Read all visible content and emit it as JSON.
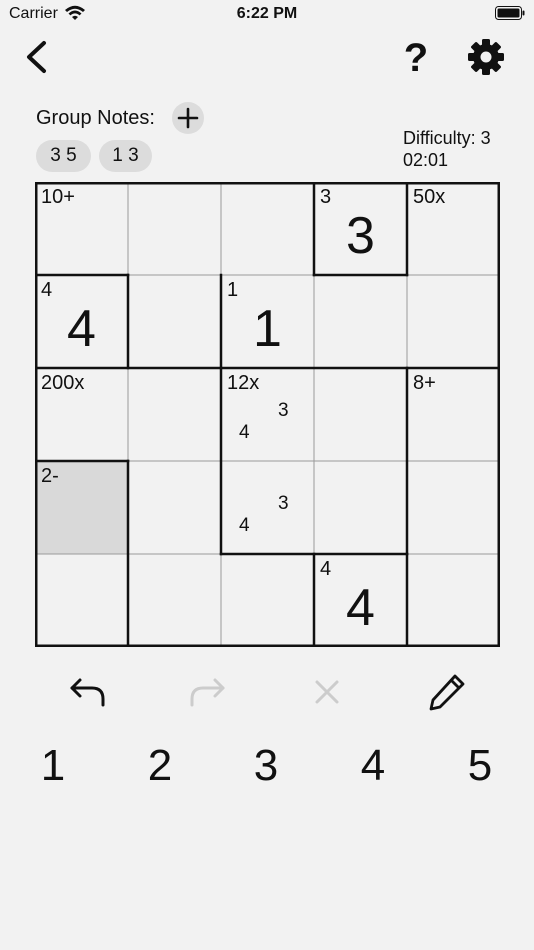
{
  "status_bar": {
    "carrier": "Carrier",
    "time": "6:22 PM"
  },
  "toolbar": {
    "help_label": "?"
  },
  "group_notes": {
    "label": "Group Notes:",
    "chips": [
      "3 5",
      "1 3"
    ]
  },
  "info": {
    "difficulty": "Difficulty: 3",
    "timer": "02:01"
  },
  "board": {
    "size": 5,
    "cells": [
      {
        "r": 0,
        "c": 0,
        "cage": "10+"
      },
      {
        "r": 0,
        "c": 3,
        "cage": "3",
        "value": "3"
      },
      {
        "r": 0,
        "c": 4,
        "cage": "50x"
      },
      {
        "r": 1,
        "c": 0,
        "cage": "4",
        "value": "4"
      },
      {
        "r": 1,
        "c": 2,
        "cage": "1",
        "value": "1"
      },
      {
        "r": 2,
        "c": 0,
        "cage": "200x"
      },
      {
        "r": 2,
        "c": 2,
        "cage": "12x",
        "notes": [
          "3",
          "4"
        ]
      },
      {
        "r": 2,
        "c": 4,
        "cage": "8+"
      },
      {
        "r": 3,
        "c": 0,
        "cage": "2-",
        "selected": true
      },
      {
        "r": 3,
        "c": 2,
        "notes": [
          "3",
          "4"
        ]
      },
      {
        "r": 4,
        "c": 3,
        "cage": "4",
        "value": "4"
      }
    ]
  },
  "actions": {
    "redo_enabled": false,
    "clear_enabled": false
  },
  "number_pad": [
    "1",
    "2",
    "3",
    "4",
    "5"
  ],
  "colors": {
    "background": "#f2f2f2",
    "selected_cell": "#d9d9d9",
    "chip": "#dcdcdc",
    "disabled": "#cccccc"
  }
}
